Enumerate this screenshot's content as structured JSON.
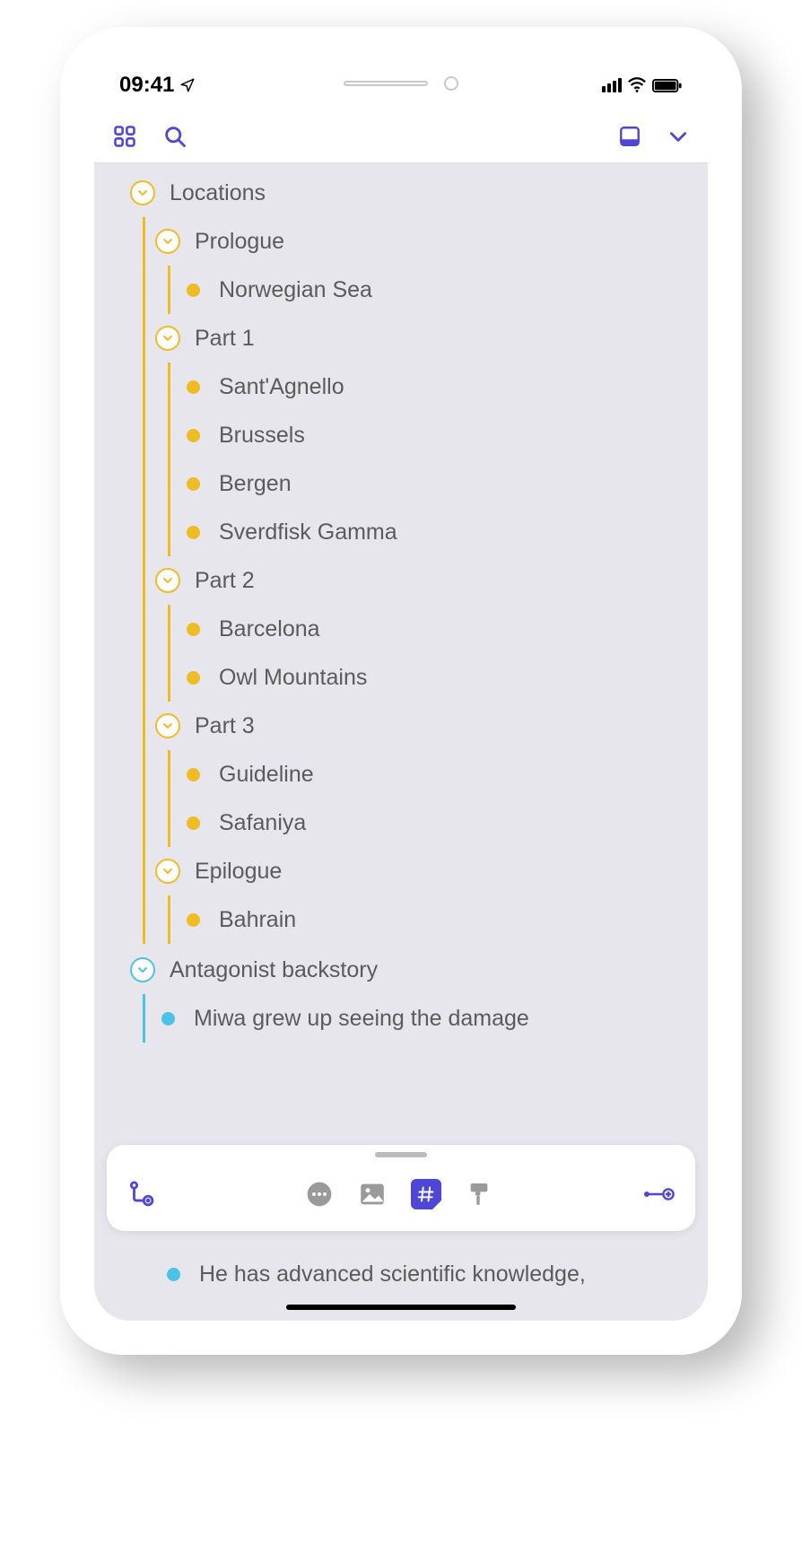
{
  "status": {
    "time": "09:41"
  },
  "colors": {
    "accent": "#4F46D6",
    "yellow": "#F0BC24",
    "blue": "#4CC2E6"
  },
  "outline": {
    "sections": [
      {
        "id": "locations",
        "label": "Locations",
        "color": "yellow",
        "groups": [
          {
            "label": "Prologue",
            "items": [
              "Norwegian Sea"
            ]
          },
          {
            "label": "Part 1",
            "items": [
              "Sant'Agnello",
              "Brussels",
              "Bergen",
              "Sverdfisk Gamma"
            ]
          },
          {
            "label": "Part 2",
            "items": [
              "Barcelona",
              "Owl Mountains"
            ]
          },
          {
            "label": "Part 3",
            "items": [
              "Guideline",
              "Safaniya"
            ]
          },
          {
            "label": "Epilogue",
            "items": [
              "Bahrain"
            ]
          }
        ]
      },
      {
        "id": "antagonist",
        "label": "Antagonist backstory",
        "color": "blue",
        "items": [
          "Miwa grew up seeing the damage",
          "He has advanced scientific knowledge,"
        ]
      }
    ]
  }
}
